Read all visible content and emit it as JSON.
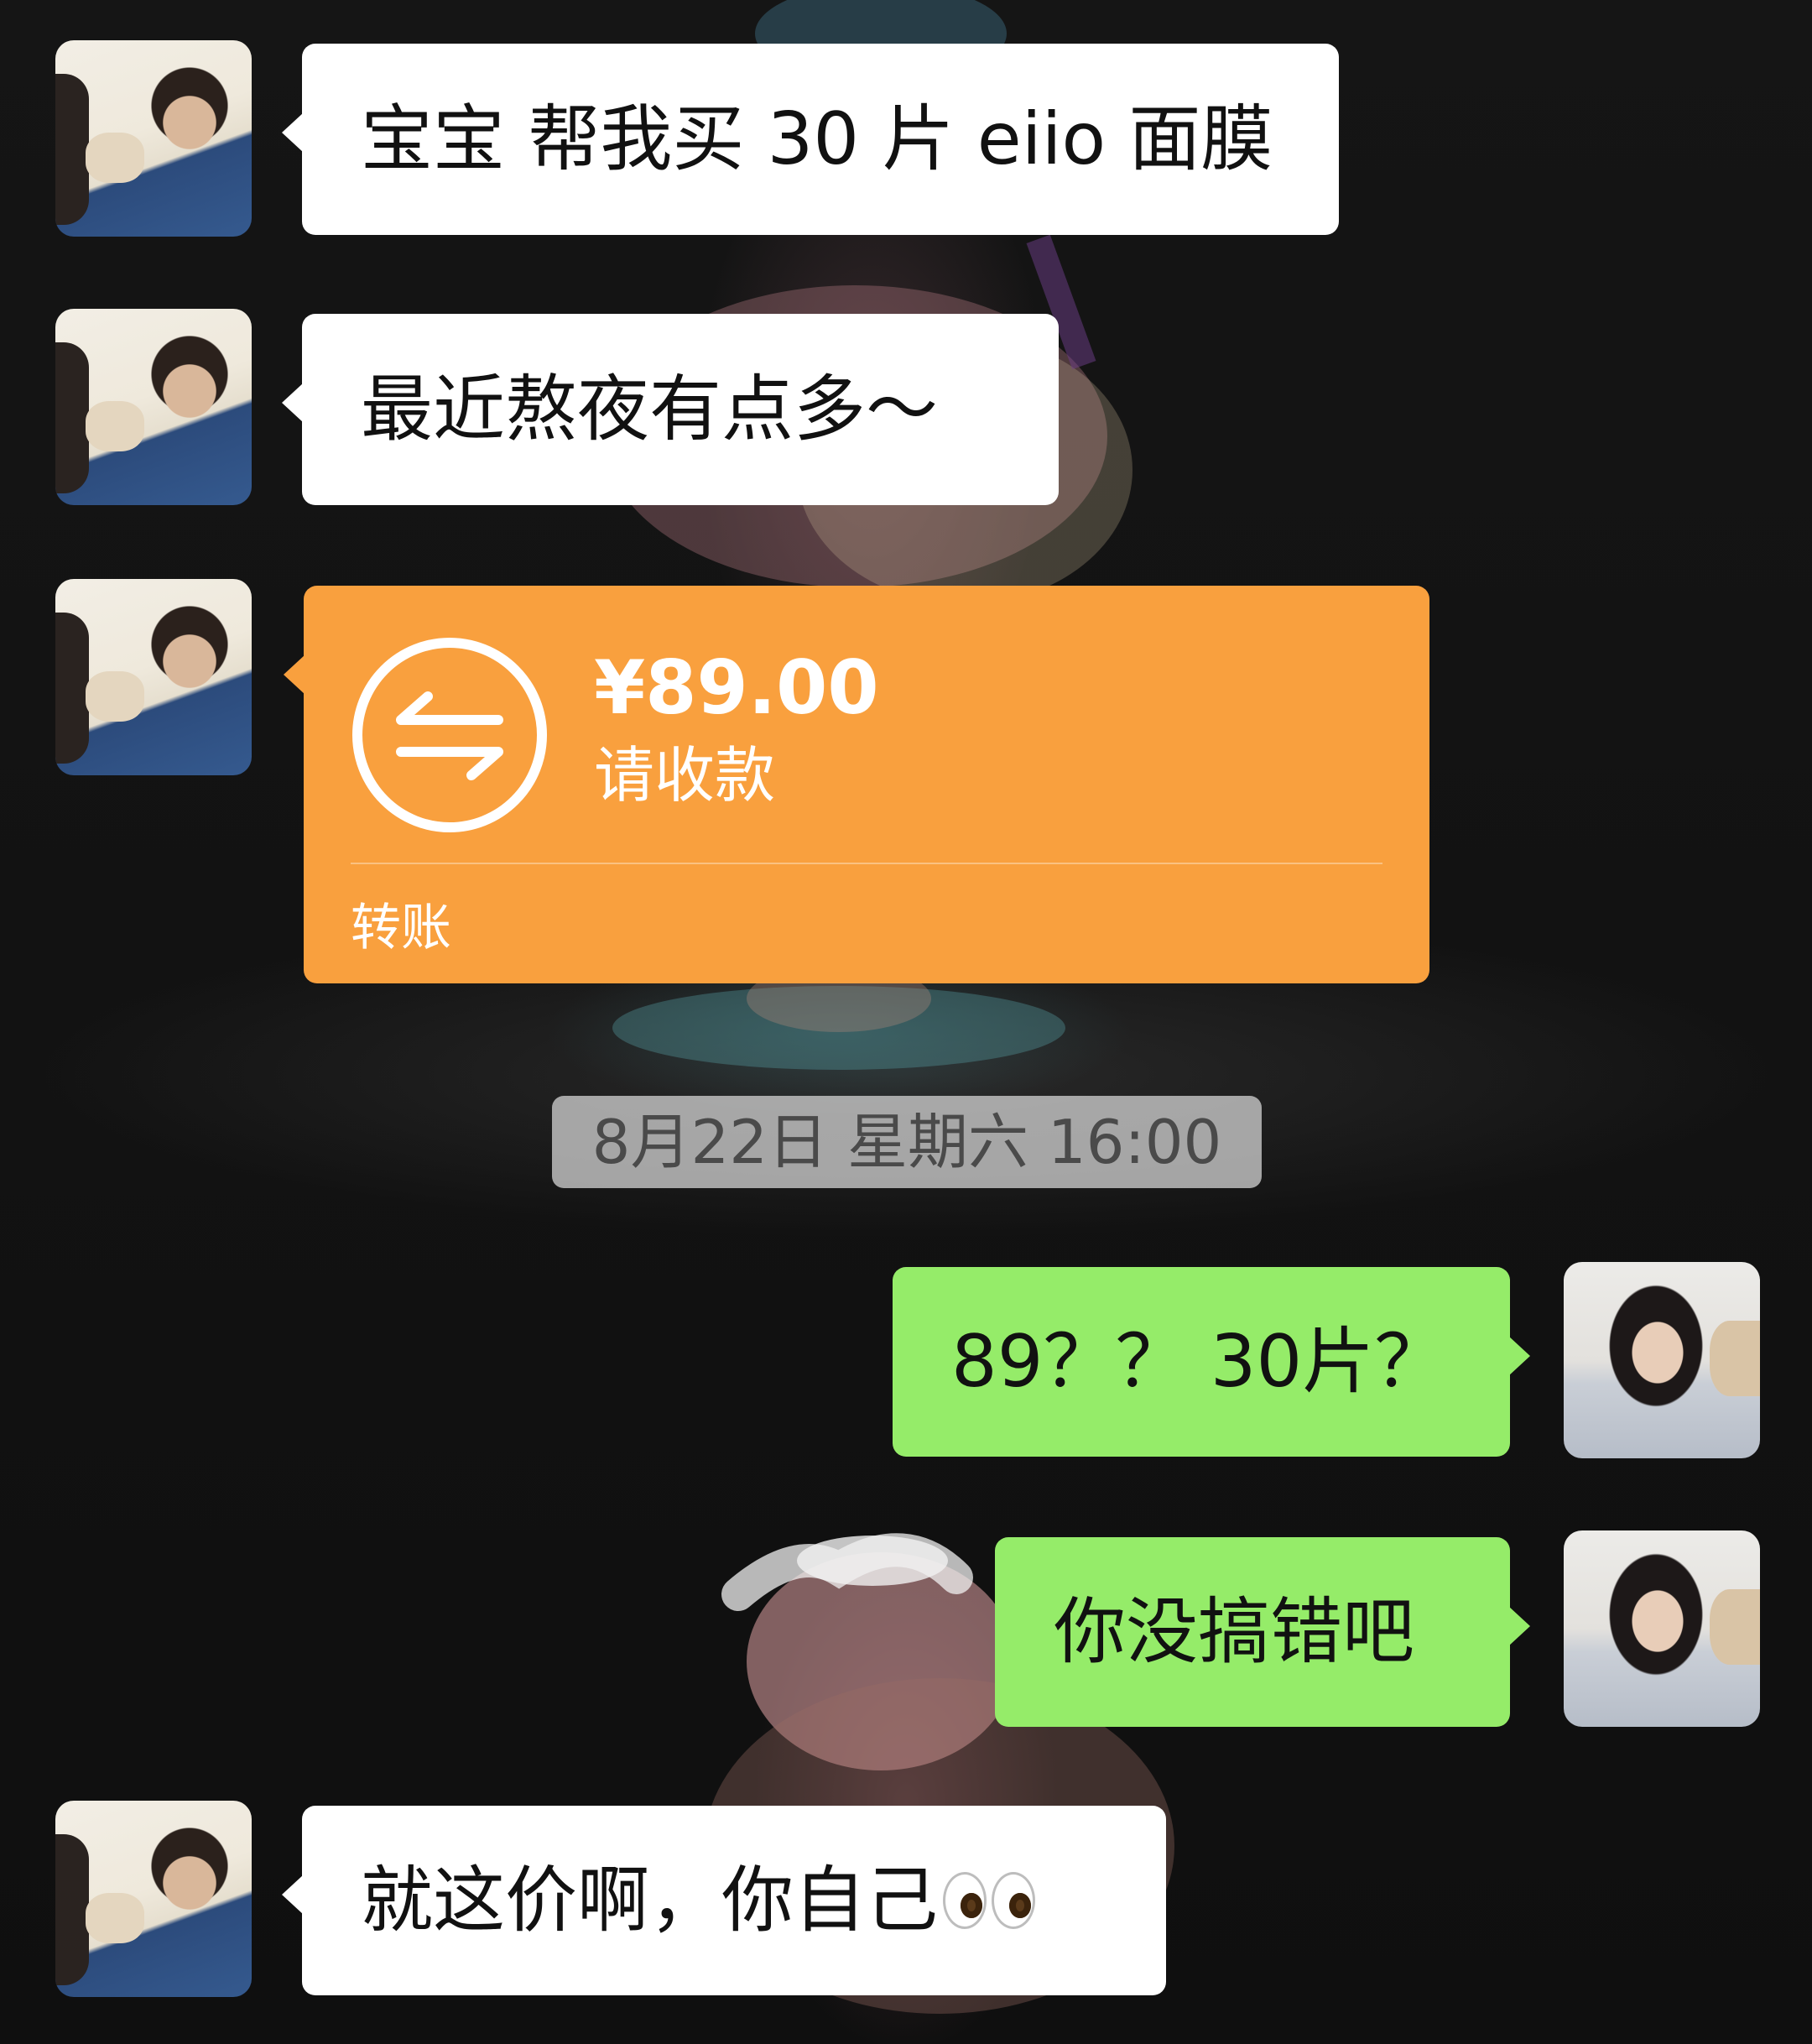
{
  "conversation": {
    "messages": [
      {
        "sender": "contact",
        "type": "text",
        "text": "宝宝 帮我买 30 片 eiio 面膜"
      },
      {
        "sender": "contact",
        "type": "text",
        "text": "最近熬夜有点多～"
      },
      {
        "sender": "contact",
        "type": "transfer",
        "amount": "¥89.00",
        "status": "请收款",
        "label": "转账"
      },
      {
        "sender": "system",
        "type": "timestamp",
        "text": "8月22日 星期六 16:00"
      },
      {
        "sender": "me",
        "type": "text",
        "text": "89？？ 30片？"
      },
      {
        "sender": "me",
        "type": "text",
        "text": "你没搞错吧"
      },
      {
        "sender": "contact",
        "type": "text",
        "text": "就这价啊，你自己",
        "emoji": "eyes-emoji"
      }
    ]
  },
  "colors": {
    "received_bubble": "#ffffff",
    "sent_bubble": "#95ec69",
    "transfer_card": "#f9a03e",
    "timestamp_pill": "#cdcdcd"
  },
  "icons": {
    "transfer": "transfer-arrows-icon",
    "emoji": "eyes-emoji"
  }
}
